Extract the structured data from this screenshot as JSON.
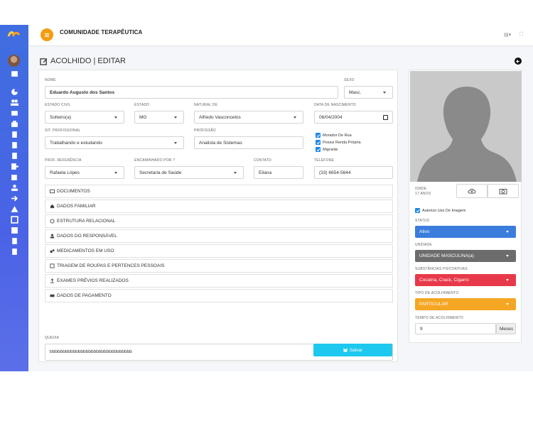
{
  "topbar": {
    "title": "COMUNIDADE TERAPÊUTICA",
    "tools": [
      "",
      ""
    ]
  },
  "page": {
    "title": "ACOLHIDO | EDITAR"
  },
  "form": {
    "nome": {
      "label": "NOME",
      "value": "Eduardo Augusto dos Santos"
    },
    "sexo": {
      "label": "SEXO",
      "value": "Masc."
    },
    "estado_civil": {
      "label": "ESTADO CIVIL",
      "value": "Solteiro(a)"
    },
    "estado": {
      "label": "ESTADO",
      "value": "MG"
    },
    "natural_de": {
      "label": "NATURAL DE",
      "value": "Alfredo Vasconcelos"
    },
    "data_nascimento": {
      "label": "DATA DE NASCIMENTO",
      "value": "06/04/2004"
    },
    "sit_profissional": {
      "label": "SIT. PROFISSIONAL",
      "value": "Trabalhando e estudando"
    },
    "profissao": {
      "label": "PROFISSÃO",
      "value": "Analista de Sistemas"
    },
    "checks": [
      "Morador De Rua",
      "Possui Renda Própria",
      "Migrante"
    ],
    "prof_referencia": {
      "label": "PROF. REFERÊNCIA",
      "value": "Rafaela Lópes"
    },
    "encaminhado_por": {
      "label": "ENCAMINHADO POR ?",
      "value": "Secretaria de Saúde"
    },
    "contato": {
      "label": "CONTATO",
      "value": "Eliana"
    },
    "telefone": {
      "label": "TELEFONE",
      "value": "(33) 6654-5644"
    },
    "sections": [
      "DOCUMENTOS",
      "DADOS FAMILIAR",
      "ESTRUTURA RELACIONAL",
      "DADOS DO RESPONSÁVEL",
      "MEDICAMENTOS EM USO",
      "TRIAGEM DE ROUPAS E PERTENCES PESSOAIS",
      "EXAMES PRÉVIOS REALIZADOS",
      "DADOS DE PAGAMENTO"
    ],
    "queixa": {
      "label": "QUEIXA",
      "value": "bbbbbbbbbbbbbbbbbbbbbbbbbbbbbbbb"
    },
    "save_label": "Salvar"
  },
  "side": {
    "idade_label": "IDADE",
    "idade_value": "17 ANOS",
    "autorizo": "Autorizo Uso De Imagem",
    "status": {
      "label": "STATUS",
      "value": "Ativo",
      "color": "#3b7ddd"
    },
    "unidade": {
      "label": "UNIDADE",
      "value": "UNIDADE MASCULINA(a)",
      "color": "#6c6c6c"
    },
    "substancias": {
      "label": "SUBSTÂNCIAS PSICOATIVAS",
      "value": "Cocaína, Crack, Cigarro",
      "color": "#e8394a"
    },
    "tipo": {
      "label": "TIPO DE ACOLHIMENTO",
      "value": "PARTICULAR",
      "color": "#f5a623"
    },
    "tempo": {
      "label": "TEMPO DE ACOLHIMENTO",
      "value": "9",
      "unit": "Meses"
    }
  }
}
